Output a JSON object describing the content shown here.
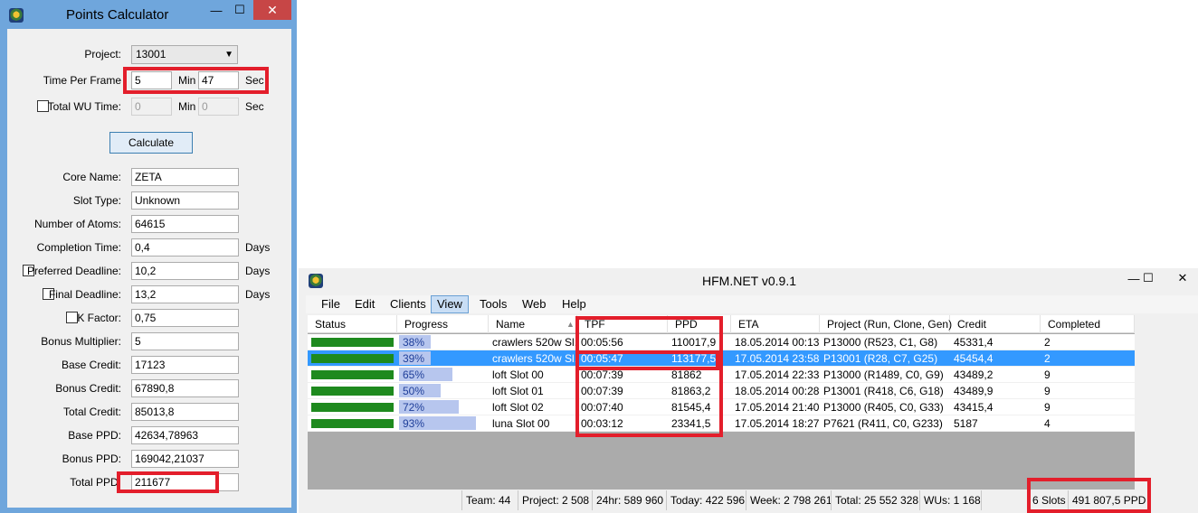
{
  "calculator": {
    "title": "Points Calculator",
    "close_glyph": "✕",
    "min_glyph": "—",
    "max_glyph": "☐",
    "project_label": "Project:",
    "project_value": "13001",
    "tpf_label": "Time Per Frame",
    "tpf_min": "5",
    "tpf_sec": "47",
    "min_unit": "Min",
    "sec_unit": "Sec",
    "total_wu_label": "Total WU Time:",
    "total_wu_min": "0",
    "total_wu_sec": "0",
    "calculate_label": "Calculate",
    "days_unit": "Days",
    "fields": [
      {
        "label": "Core Name:",
        "value": "ZETA"
      },
      {
        "label": "Slot Type:",
        "value": "Unknown"
      },
      {
        "label": "Number of Atoms:",
        "value": "64615"
      },
      {
        "label": "Completion Time:",
        "value": "0,4"
      },
      {
        "label": "Preferred Deadline:",
        "value": "10,2"
      },
      {
        "label": "Final Deadline:",
        "value": "13,2"
      },
      {
        "label": "K Factor:",
        "value": "0,75"
      },
      {
        "label": "Bonus Multiplier:",
        "value": "5"
      },
      {
        "label": "Base Credit:",
        "value": "17123"
      },
      {
        "label": "Bonus Credit:",
        "value": "67890,8"
      },
      {
        "label": "Total Credit:",
        "value": "85013,8"
      },
      {
        "label": "Base PPD:",
        "value": "42634,78963"
      },
      {
        "label": "Bonus PPD:",
        "value": "169042,21037"
      },
      {
        "label": "Total PPD:",
        "value": "211677"
      }
    ]
  },
  "hfm": {
    "title": "HFM.NET v0.9.1",
    "menu": [
      "File",
      "Edit",
      "Clients",
      "View",
      "Tools",
      "Web",
      "Help"
    ],
    "columns": [
      "Status",
      "Progress",
      "Name",
      "TPF",
      "PPD",
      "ETA",
      "Project (Run, Clone, Gen)",
      "Credit",
      "Completed"
    ],
    "sort_glyph": "▲",
    "rows": [
      {
        "progress": 0.38,
        "progress_label": "38%",
        "name": "crawlers 520w Sl...",
        "tpf": "00:05:56",
        "ppd": "110017,9",
        "eta": "18.05.2014 00:13",
        "project": "P13000 (R523, C1, G8)",
        "credit": "45331,4",
        "completed": "2"
      },
      {
        "progress": 0.39,
        "progress_label": "39%",
        "name": "crawlers 520w Sl...",
        "tpf": "00:05:47",
        "ppd": "113177,5",
        "eta": "17.05.2014 23:58",
        "project": "P13001 (R28, C7, G25)",
        "credit": "45454,4",
        "completed": "2"
      },
      {
        "progress": 0.65,
        "progress_label": "65%",
        "name": "loft Slot 00",
        "tpf": "00:07:39",
        "ppd": "81862",
        "eta": "17.05.2014 22:33",
        "project": "P13000 (R1489, C0, G9)",
        "credit": "43489,2",
        "completed": "9"
      },
      {
        "progress": 0.5,
        "progress_label": "50%",
        "name": "loft Slot 01",
        "tpf": "00:07:39",
        "ppd": "81863,2",
        "eta": "18.05.2014 00:28",
        "project": "P13001 (R418, C6, G18)",
        "credit": "43489,9",
        "completed": "9"
      },
      {
        "progress": 0.72,
        "progress_label": "72%",
        "name": "loft Slot 02",
        "tpf": "00:07:40",
        "ppd": "81545,4",
        "eta": "17.05.2014 21:40",
        "project": "P13000 (R405, C0, G33)",
        "credit": "43415,4",
        "completed": "9"
      },
      {
        "progress": 0.93,
        "progress_label": "93%",
        "name": "luna Slot 00",
        "tpf": "00:03:12",
        "ppd": "23341,5",
        "eta": "17.05.2014 18:27",
        "project": "P7621 (R411, C0, G233)",
        "credit": "5187",
        "completed": "4"
      }
    ],
    "status": {
      "team": "Team: 44",
      "project": "Project: 2 508",
      "h24": "24hr: 589 960",
      "today": "Today: 422 596",
      "week": "Week: 2 798 261",
      "total": "Total: 25 552 328",
      "wus": "WUs: 1 168",
      "slots": "6 Slots",
      "ppd": "491 807,5 PPD"
    }
  }
}
